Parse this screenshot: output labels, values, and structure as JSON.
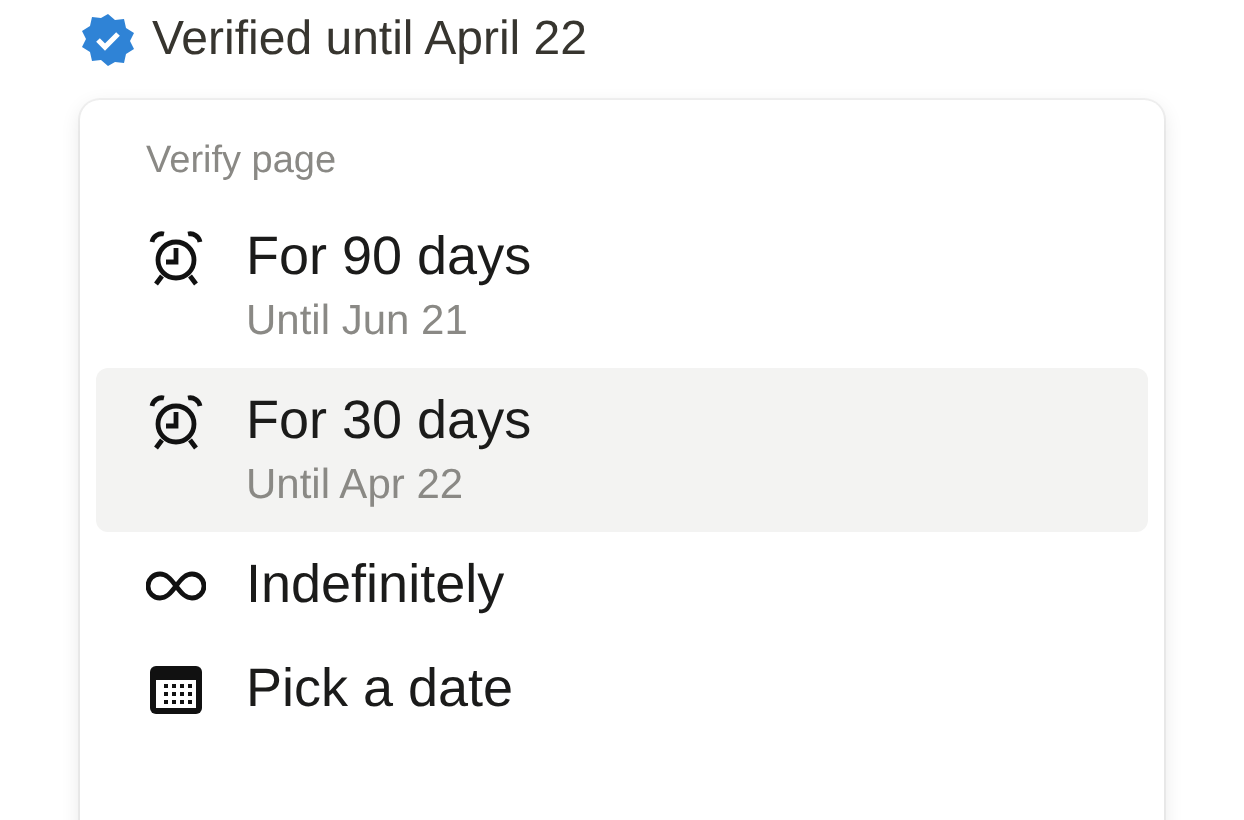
{
  "header": {
    "label": "Verified until April 22"
  },
  "menu": {
    "section_label": "Verify page",
    "items": [
      {
        "kind": "alarm",
        "label": "For 90 days",
        "detail": "Until Jun 21",
        "selected": false
      },
      {
        "kind": "alarm",
        "label": "For 30 days",
        "detail": "Until Apr 22",
        "selected": true
      },
      {
        "kind": "infinity",
        "label": "Indefinitely",
        "selected": false
      },
      {
        "kind": "calendar",
        "label": "Pick a date",
        "selected": false
      }
    ]
  }
}
